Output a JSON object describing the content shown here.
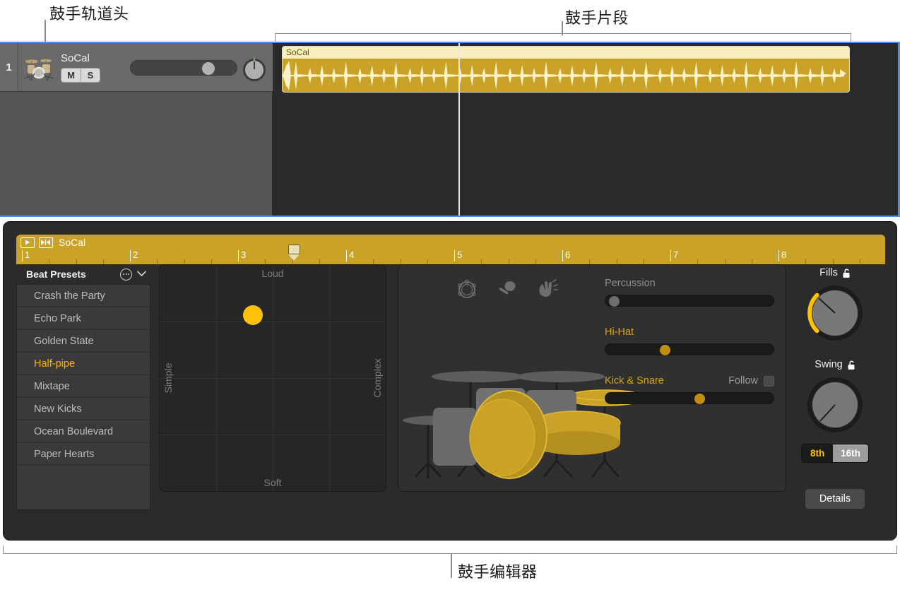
{
  "annotations": {
    "track_header": "鼓手轨道头",
    "region": "鼓手片段",
    "editor": "鼓手编辑器"
  },
  "track": {
    "number": "1",
    "name": "SoCal",
    "mute_label": "M",
    "solo_label": "S",
    "icon": "drum-kit-icon",
    "volume_percent": 68,
    "pan_value": 0
  },
  "region": {
    "name": "SoCal",
    "color": "#c9a227",
    "title_color": "#faefbc"
  },
  "editor": {
    "ruler": {
      "region_name": "SoCal",
      "play_icon": "play-icon",
      "fit_icon": "fit-region-icon",
      "bars": [
        "1",
        "2",
        "3",
        "4",
        "5",
        "6",
        "7",
        "8"
      ],
      "playhead_bar": 3.5
    },
    "presets": {
      "title": "Beat Presets",
      "menu_icon": "circled-ellipsis-icon",
      "chevron_icon": "chevron-down-icon",
      "selected": "Half-pipe",
      "items": [
        "Crash the Party",
        "Echo Park",
        "Golden State",
        "Half-pipe",
        "Mixtape",
        "New Kicks",
        "Ocean Boulevard",
        "Paper Hearts"
      ]
    },
    "xy_pad": {
      "top_label": "Loud",
      "bottom_label": "Soft",
      "left_label": "Simple",
      "right_label": "Complex",
      "puck_x_percent": 41,
      "puck_y_percent": 22,
      "puck_color": "#ffc107"
    },
    "kit": {
      "percussion_icons": [
        "tambourine-icon",
        "shaker-icon",
        "clap-icon"
      ],
      "artwork": "drum-kit-illustration"
    },
    "sliders": [
      {
        "label": "Percussion",
        "value_percent": 2,
        "active": false,
        "thumb": "grey"
      },
      {
        "label": "Hi-Hat",
        "value_percent": 34,
        "active": true,
        "thumb": "gold"
      },
      {
        "label": "Kick & Snare",
        "value_percent": 56,
        "active": true,
        "thumb": "gold"
      }
    ],
    "follow": {
      "label": "Follow",
      "checked": false
    },
    "knobs": [
      {
        "label": "Fills",
        "lock_icon": "unlocked-icon",
        "value_percent": 18,
        "arc": true
      },
      {
        "label": "Swing",
        "lock_icon": "unlocked-icon",
        "value_percent": 0,
        "arc": false
      }
    ],
    "swing_toggle": {
      "options": [
        "8th",
        "16th"
      ],
      "selected": "8th"
    },
    "details_button": "Details"
  }
}
